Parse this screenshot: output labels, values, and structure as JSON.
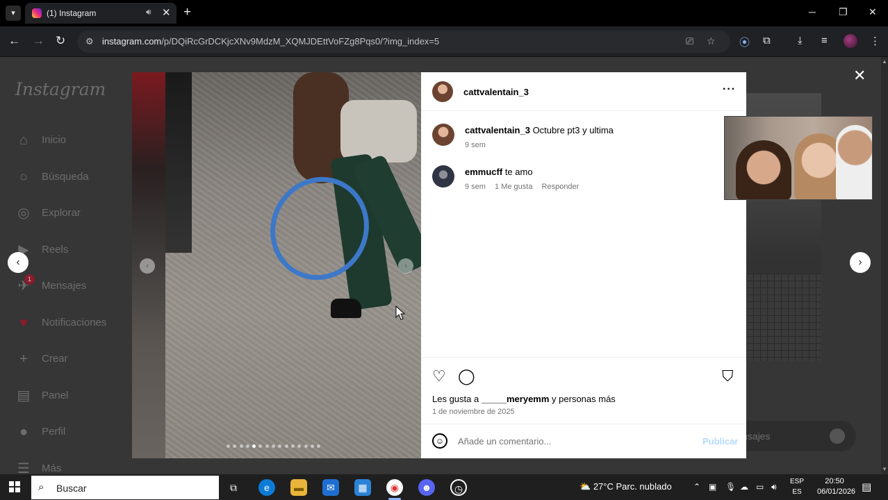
{
  "browser": {
    "tab_title": "(1) Instagram",
    "url_host": "instagram.com",
    "url_path": "/p/DQiRcGrDCKjcXNv9MdzM_XQMJDEttVoFZg8Pqs0/?img_index=5"
  },
  "sidebar": {
    "logo": "Instagram",
    "items": [
      {
        "label": "Inicio",
        "icon": "home-icon"
      },
      {
        "label": "Búsqueda",
        "icon": "search-icon"
      },
      {
        "label": "Explorar",
        "icon": "compass-icon"
      },
      {
        "label": "Reels",
        "icon": "reels-icon"
      },
      {
        "label": "Mensajes",
        "icon": "messenger-icon",
        "badge": "1"
      },
      {
        "label": "Notificaciones",
        "icon": "heart-icon"
      },
      {
        "label": "Crear",
        "icon": "plus-icon"
      },
      {
        "label": "Panel",
        "icon": "chart-icon"
      },
      {
        "label": "Perfil",
        "icon": "avatar-icon"
      },
      {
        "label": "Más",
        "icon": "menu-icon"
      }
    ]
  },
  "messages_pill": {
    "label": "nsajes"
  },
  "post": {
    "carousel": {
      "total": 15,
      "current": 5
    },
    "author": "cattvalentain_3",
    "comments": [
      {
        "user": "cattvalentain_3",
        "text": "Octubre pt3 y ultima",
        "meta": [
          "9 sem"
        ]
      },
      {
        "user": "emmucff",
        "text": "te amo",
        "meta": [
          "9 sem",
          "1 Me gusta",
          "Responder"
        ]
      }
    ],
    "likes_prefix": "Les gusta a",
    "likes_user": "_____meryemm",
    "likes_suffix": "y personas más",
    "date": "1 de noviembre de 2025",
    "comment_placeholder": "Añade un comentario...",
    "publish_label": "Publicar"
  },
  "taskbar": {
    "search_placeholder": "Buscar",
    "weather": "27°C  Parc. nublado",
    "lang_top": "ESP",
    "lang_bottom": "ES",
    "time": "20:50",
    "date": "06/01/2026",
    "notification_count": "2"
  }
}
